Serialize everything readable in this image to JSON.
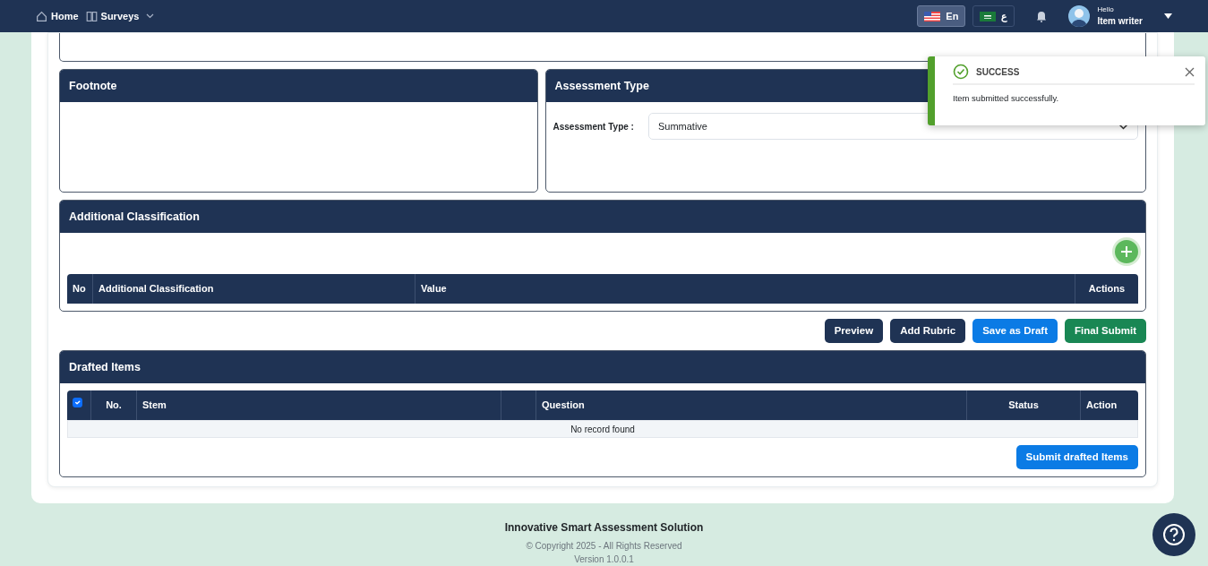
{
  "navbar": {
    "items": [
      {
        "label": "Home",
        "kind": "home"
      },
      {
        "label": "Surveys",
        "kind": "book",
        "dropdown": true
      }
    ],
    "languages": [
      {
        "label": "En",
        "kind": "us",
        "selected": true
      },
      {
        "label": "ع",
        "kind": "sa",
        "selected": false
      }
    ],
    "user": {
      "greeting": "Hello",
      "name": "Item writer"
    }
  },
  "footnote": {
    "title": "Footnote"
  },
  "assessment_type": {
    "title": "Assessment Type",
    "label": "Assessment Type :",
    "value": "Summative"
  },
  "additional_classification": {
    "title": "Additional Classification",
    "columns": [
      "No",
      "Additional Classification",
      "Value",
      "Actions"
    ]
  },
  "action_buttons": [
    {
      "label": "Preview",
      "kind": "dark"
    },
    {
      "label": "Add Rubric",
      "kind": "dark"
    },
    {
      "label": "Save as Draft",
      "kind": "primary"
    },
    {
      "label": "Final Submit",
      "kind": "success"
    }
  ],
  "drafted_items": {
    "title": "Drafted Items",
    "columns": [
      {
        "kind": "checkbox",
        "checked": true
      },
      {
        "kind": "text",
        "label": "No."
      },
      {
        "kind": "text",
        "label": "Stem"
      },
      {
        "kind": "blank"
      },
      {
        "kind": "text",
        "label": "Question"
      },
      {
        "kind": "text",
        "label": "Status"
      },
      {
        "kind": "text",
        "label": "Action"
      }
    ],
    "empty_message": "No record found",
    "submit_button": "Submit drafted Items"
  },
  "toast": {
    "title": "SUCCESS",
    "message": "Item submitted successfully."
  },
  "footer": {
    "title": "Innovative Smart Assessment Solution",
    "copyright": "© Copyright 2025 - All Rights Reserved",
    "version": "Version 1.0.0.1"
  }
}
